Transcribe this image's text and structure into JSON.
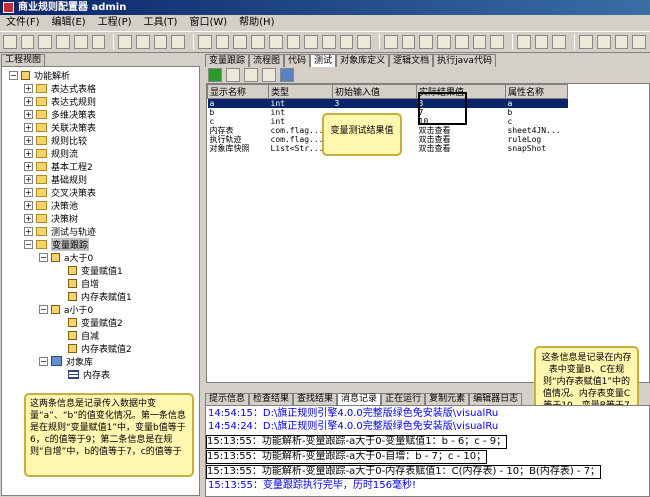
{
  "window": {
    "title": "商业规则配置器 admin"
  },
  "menu": {
    "items": [
      "文件(F)",
      "编辑(E)",
      "工程(P)",
      "工具(T)",
      "窗口(W)",
      "帮助(H)"
    ]
  },
  "left_panel": {
    "tab": "工程视图"
  },
  "tree": {
    "root": "功能解析",
    "items": [
      "表达式表格",
      "表达式规则",
      "多维决策表",
      "关联决策表",
      "规则比较",
      "规则流",
      "基本工程2",
      "基础规则",
      "交叉决策表",
      "决策池",
      "决策树",
      "测试与轨迹"
    ],
    "selected": "变量跟踪",
    "gt0": {
      "label": "a大于0",
      "children": [
        "变量赋值1",
        "自增",
        "内存表赋值1"
      ]
    },
    "lt0": {
      "label": "a小于0",
      "children": [
        "变量赋值2",
        "自减",
        "内存表赋值2"
      ]
    },
    "objlib": {
      "label": "对象库",
      "children": [
        "内存表"
      ]
    }
  },
  "right_tabs": [
    "变量跟踪",
    "流程图",
    "代码",
    "测试",
    "对象库定义",
    "逻辑文档",
    "执行java代码"
  ],
  "right_active_tab": "测试",
  "grid": {
    "headers": [
      "显示名称",
      "类型",
      "初始输入值",
      "实际结果值",
      "属性名称"
    ],
    "rows": [
      [
        "a",
        "int",
        "3",
        "3",
        "a"
      ],
      [
        "b",
        "int",
        "",
        "7",
        "b"
      ],
      [
        "c",
        "int",
        "",
        "10",
        "c"
      ],
      [
        "内存表",
        "com.flag...",
        "",
        "双击查看",
        "sheet4JN..."
      ],
      [
        "执行轨迹",
        "com.flag...",
        "",
        "双击查看",
        "ruleLog"
      ],
      [
        "对象库快照",
        "List<Str...",
        "",
        "双击查看",
        "snapShot"
      ]
    ]
  },
  "callouts": {
    "middle": "变量测试结果值",
    "right": "这条信息是记录在内存表中变量B、C在规则“内存表赋值1”中的值情况。内存表变量C等于10，变量B等于7",
    "left": "这两条信息是记录传入数据中变量“a”、“b”的值变化情况。第一条信息是在规则“变量赋值1”中，变量b值等于6，c的值等于9；第二条信息是在规则“自增”中，b的值等于7，c的值等于"
  },
  "bottom_tabs": [
    "提示信息",
    "检查结果",
    "查找结果",
    "消息记录",
    "正在运行",
    "复制元素",
    "编辑器日志"
  ],
  "bottom_active_tab": "消息记录",
  "log_lines": [
    "14:54:15：D:\\旗正规则引擎4.0.0完整版绿色免安装版\\visualRu",
    "14:54:24：D:\\旗正规则引擎4.0.0完整版绿色免安装版\\visualRu",
    "15:13:55：功能解析-变量跟踪-a大于0-变量赋值1：b - 6；c - 9；",
    "15:13:55：功能解析-变量跟踪-a大于0-自增：b - 7；c - 10；",
    "15:13:55：功能解析-变量跟踪-a大于0-内存表赋值1：C(内存表) - 10；B(内存表) - 7；",
    "15:13:55：变量跟踪执行完毕，历时156毫秒!"
  ]
}
